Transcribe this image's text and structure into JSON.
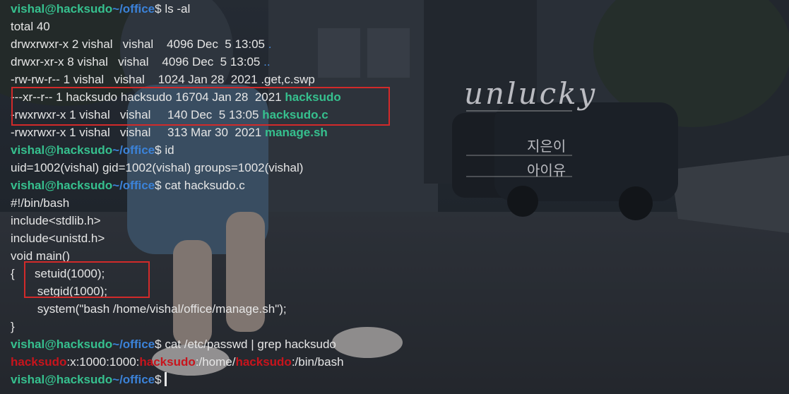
{
  "wallpaper": {
    "song_title": "unlucky",
    "artist_line1": "지은이",
    "artist_line2": "아이유"
  },
  "prompt": {
    "user": "vishal@hacksudo",
    "path": "~/office",
    "symbol": "$"
  },
  "terminal": [
    {
      "type": "prompt",
      "cmd": "ls -al"
    },
    {
      "type": "text",
      "text": "total 40"
    },
    {
      "type": "ls",
      "meta": "drwxrwxr-x 2 vishal   vishal    4096 Dec  5 13:05 ",
      "name": ".",
      "kind": "dir"
    },
    {
      "type": "ls",
      "meta": "drwxr-xr-x 8 vishal   vishal    4096 Dec  5 13:05 ",
      "name": "..",
      "kind": "dir"
    },
    {
      "type": "ls",
      "meta": "-rw-rw-r-- 1 vishal   vishal    1024 Jan 28  2021 ",
      "name": ".get,c.swp",
      "kind": "file"
    },
    {
      "type": "ls",
      "meta": "---xr--r-- 1 hacksudo hacksudo 16704 Jan 28  2021 ",
      "name": "hacksudo",
      "kind": "exe"
    },
    {
      "type": "ls",
      "meta": "-rwxrwxr-x 1 vishal   vishal     140 Dec  5 13:05 ",
      "name": "hacksudo.c",
      "kind": "exe"
    },
    {
      "type": "ls",
      "meta": "-rwxrwxr-x 1 vishal   vishal     313 Mar 30  2021 ",
      "name": "manage.sh",
      "kind": "exe"
    },
    {
      "type": "prompt",
      "cmd": "id"
    },
    {
      "type": "text",
      "text": "uid=1002(vishal) gid=1002(vishal) groups=1002(vishal)"
    },
    {
      "type": "prompt",
      "cmd": "cat hacksudo.c"
    },
    {
      "type": "text",
      "text": "#!/bin/bash"
    },
    {
      "type": "text",
      "text": "include<stdlib.h>"
    },
    {
      "type": "text",
      "text": "include<unistd.h>"
    },
    {
      "type": "text",
      "text": "void main()"
    },
    {
      "type": "text",
      "text": "{      setuid(1000);"
    },
    {
      "type": "text",
      "text": "        setgid(1000);"
    },
    {
      "type": "text",
      "text": "        system(\"bash /home/vishal/office/manage.sh\");"
    },
    {
      "type": "text",
      "text": "}"
    },
    {
      "type": "prompt",
      "cmd": "cat /etc/passwd | grep hacksudo"
    },
    {
      "type": "passwd",
      "segments": [
        {
          "t": "hacksudo",
          "hl": true
        },
        {
          "t": ":x:1000:1000:",
          "hl": false
        },
        {
          "t": "hacksudo",
          "hl": true
        },
        {
          "t": ":/home/",
          "hl": false
        },
        {
          "t": "hacksudo",
          "hl": true
        },
        {
          "t": ":/bin/bash",
          "hl": false
        }
      ]
    },
    {
      "type": "prompt",
      "cmd": "",
      "cursor": true
    }
  ]
}
